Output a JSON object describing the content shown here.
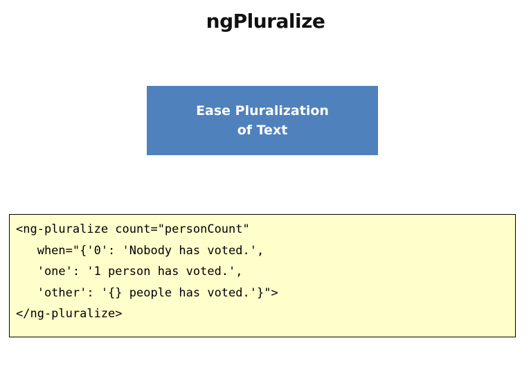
{
  "slide": {
    "title": "ngPluralize"
  },
  "callout": {
    "line1": "Ease Pluralization",
    "line2": "of Text",
    "background_color": "#4f81bd",
    "text_color": "#ffffff"
  },
  "code_block": {
    "background_color": "#ffffcc",
    "lines": [
      "<ng-pluralize count=\"personCount\"",
      "   when=\"{'0': 'Nobody has voted.',",
      "   'one': '1 person has voted.',",
      "   'other': '{} people has voted.'}\">",
      "</ng-pluralize>"
    ]
  }
}
